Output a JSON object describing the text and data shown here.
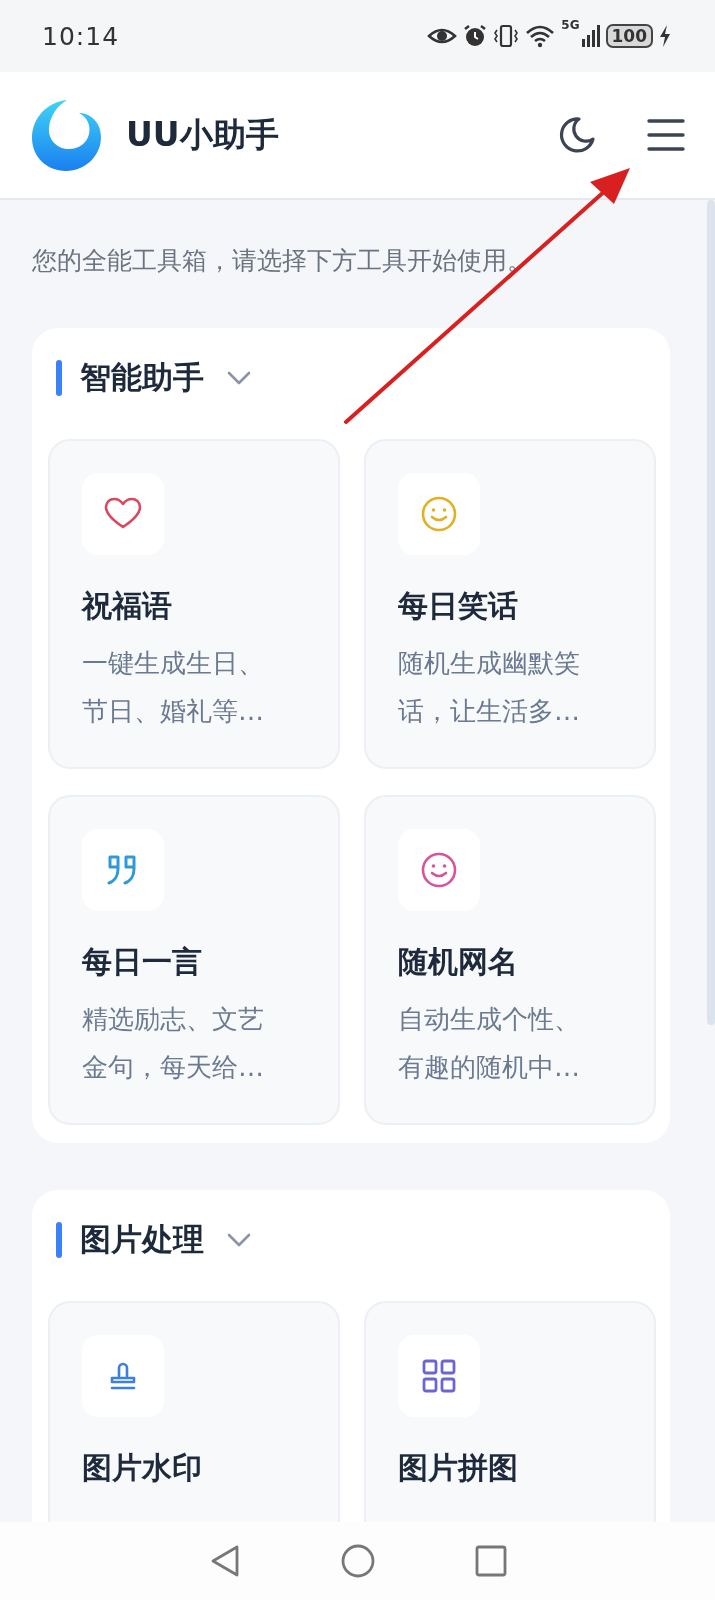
{
  "status_bar": {
    "time": "10:14",
    "network": "5G",
    "battery": "100"
  },
  "header": {
    "title": "UU小助手"
  },
  "subtitle": "您的全能工具箱，请选择下方工具开始使用。",
  "sections": [
    {
      "title": "智能助手",
      "expanded": true,
      "tools": [
        {
          "kind": "heart",
          "color": "#d9485f",
          "title": "祝福语",
          "description": "一键生成生日、节日、婚礼等…"
        },
        {
          "kind": "smile",
          "color": "#e0b120",
          "title": "每日笑话",
          "description": "随机生成幽默笑话，让生活多…"
        },
        {
          "kind": "quote",
          "color": "#2e9bd6",
          "title": "每日一言",
          "description": "精选励志、文艺金句，每天给…"
        },
        {
          "kind": "smile",
          "color": "#d6549b",
          "title": "随机网名",
          "description": "自动生成个性、有趣的随机中…"
        }
      ]
    },
    {
      "title": "图片处理",
      "expanded": true,
      "tools": [
        {
          "kind": "stamp",
          "color": "#3b7fe0",
          "title": "图片水印"
        },
        {
          "kind": "grid",
          "color": "#6b66d2",
          "title": "图片拼图"
        }
      ]
    }
  ]
}
